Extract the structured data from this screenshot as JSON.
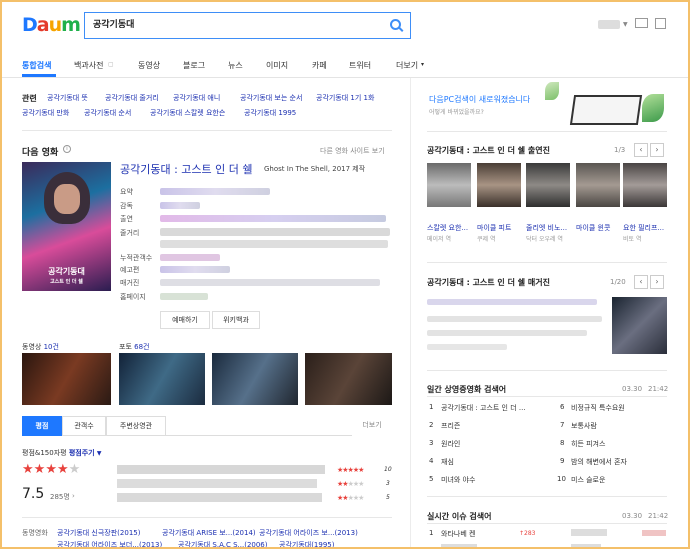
{
  "header": {
    "logo": [
      "D",
      "a",
      "u",
      "m"
    ],
    "search_value": "공각기동대"
  },
  "tabs": [
    "통합검색",
    "백과사전",
    "동영상",
    "블로그",
    "뉴스",
    "이미지",
    "카페",
    "트위터",
    "더보기"
  ],
  "related": {
    "label": "관련",
    "row1": [
      "공각기동대 뜻",
      "공각기동대 줄거리",
      "공각기동대 애니",
      "공각기동대 보는 순서",
      "공각기동대 1기 1화"
    ],
    "row2": [
      "공각기동대 만화",
      "공각기동대 순서",
      "공각기동대 스칼렛 요한슨",
      "공각기동대 1995"
    ]
  },
  "movie": {
    "section_title": "다음 영화",
    "other_site": "다른 영화 사이트 보기",
    "title": "공각기동대 : 고스트 인 더 쉘",
    "subtitle": "Ghost In The Shell, 2017 제작",
    "labels": [
      "요약",
      "감독",
      "출연",
      "줄거리",
      "누적관객수",
      "예고편",
      "매거진",
      "홈페이지"
    ],
    "poster_title": "공각기동대",
    "poster_sub": "고스트 인 더 쉘",
    "btn_rate": "예매하기",
    "btn_wiki": "위키백과",
    "video_label": "동영상",
    "video_count": "10건",
    "photo_label": "포토",
    "photo_count": "68건",
    "vtabs": [
      "평점",
      "관객수",
      "주변상영관"
    ],
    "more": "더보기",
    "rating_label": "평점&150자평",
    "rating_link": "평점주기",
    "rating_value": "7.5",
    "rating_count": "285명",
    "rating_stars": 3.75,
    "mini_nums": [
      "10",
      "3",
      "5"
    ],
    "series_label": "동명영화",
    "series_row1": [
      "공각기동대 신극장판(2015)",
      "공각기동대 ARISE 보...(2014)",
      "공각기동대 어라이즈 보...(2013)"
    ],
    "series_row2": [
      "공각기동대 어라이즈 보더...(2013)",
      "공각기동대 S.A.C S...(2006)",
      "공각기동대(1995)"
    ]
  },
  "promo": {
    "title": "다음PC검색이 새로워졌습니다",
    "sub": "어떻게 바뀌었을까요?"
  },
  "cast": {
    "title": "공각기동대 : 고스트 인 더 쉘 출연진",
    "pager": "1/3",
    "names": [
      "스칼렛 요한...",
      "마이클 피트",
      "줄리엣 비노...",
      "마이클 윈콧",
      "요한 필리프..."
    ],
    "roles": [
      "메이저 역",
      "쿠제 역",
      "닥터 오우레 역",
      "",
      "비토 역"
    ]
  },
  "magazine": {
    "title": "공각기동대 : 고스트 인 더 쉘 매거진",
    "pager": "1/20"
  },
  "ranking": {
    "title": "일간 상영중영화 검색어",
    "date": "03.30",
    "time": "21:42",
    "items": [
      {
        "n": "1",
        "t": "공각기동대 : 고스트 인 더 ..."
      },
      {
        "n": "2",
        "t": "프리즌"
      },
      {
        "n": "3",
        "t": "원라인"
      },
      {
        "n": "4",
        "t": "재심"
      },
      {
        "n": "5",
        "t": "미녀와 야수"
      },
      {
        "n": "6",
        "t": "비정규직 특수요원"
      },
      {
        "n": "7",
        "t": "보통사람"
      },
      {
        "n": "8",
        "t": "히든 피겨스"
      },
      {
        "n": "9",
        "t": "밤의 해변에서 혼자"
      },
      {
        "n": "10",
        "t": "미스 슬로운"
      }
    ]
  },
  "issue": {
    "title": "실시간 이슈 검색어",
    "date": "03.30",
    "time": "21:42",
    "item1": "와타나베 켄",
    "item1_n": "1",
    "item1_change": "283"
  }
}
